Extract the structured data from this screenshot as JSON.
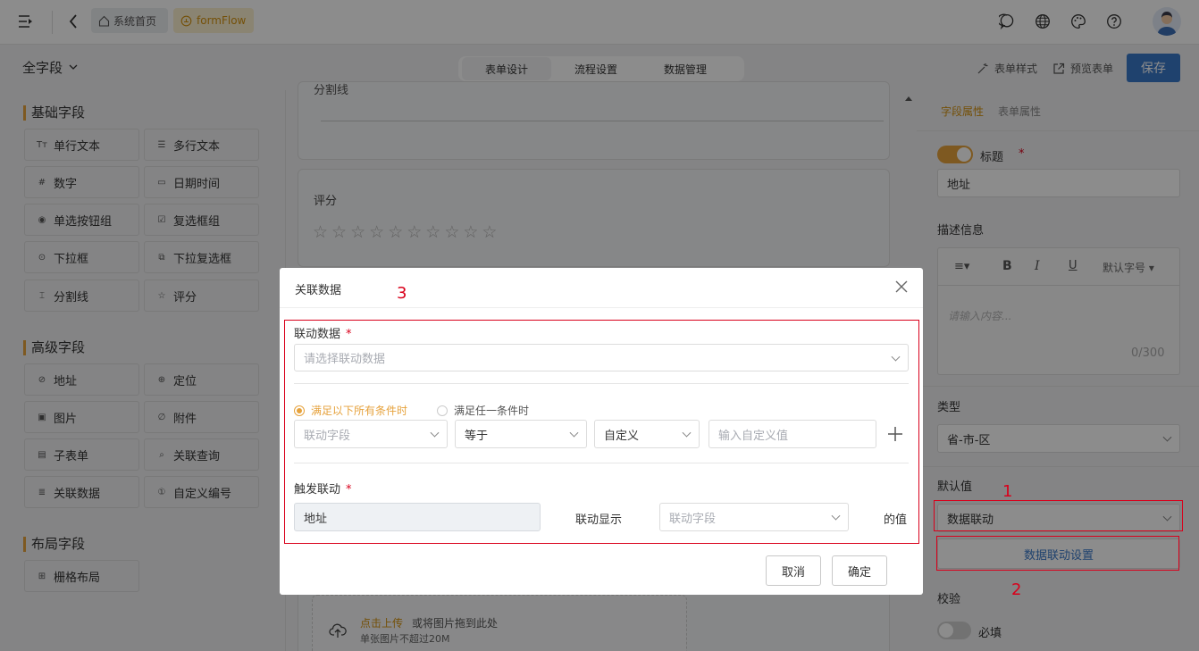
{
  "topbar": {
    "home_tag": "系统首页",
    "app_tag": "formFlow"
  },
  "subbar": {
    "field_scope": "全字段",
    "tabs": [
      "表单设计",
      "流程设置",
      "数据管理"
    ],
    "form_style": "表单样式",
    "preview": "预览表单",
    "save": "保存"
  },
  "left": {
    "basic_title": "基础字段",
    "basic_fields": [
      "单行文本",
      "多行文本",
      "数字",
      "日期时间",
      "单选按钮组",
      "复选框组",
      "下拉框",
      "下拉复选框",
      "分割线",
      "评分"
    ],
    "advanced_title": "高级字段",
    "advanced_fields": [
      "地址",
      "定位",
      "图片",
      "附件",
      "子表单",
      "关联查询",
      "关联数据",
      "自定义编号"
    ],
    "layout_title": "布局字段",
    "layout_fields": [
      "栅格布局"
    ]
  },
  "canvas": {
    "divider_label": "分割线",
    "rating_label": "评分",
    "rating_stars": 10,
    "upload_link": "点击上传",
    "upload_hint": "或将图片拖到此处",
    "upload_limit": "单张图片不超过20M"
  },
  "right": {
    "tab_field": "字段属性",
    "tab_form": "表单属性",
    "title_label": "标题",
    "title_value": "地址",
    "desc_label": "描述信息",
    "font_size": "默认字号",
    "desc_placeholder": "请输入内容...",
    "desc_counter": "0/300",
    "type_label": "类型",
    "type_value": "省-市-区",
    "default_label": "默认值",
    "default_value": "数据联动",
    "linkage_settings": "数据联动设置",
    "validate_label": "校验",
    "required_label": "必填"
  },
  "modal": {
    "title": "关联数据",
    "link_data_label": "联动数据",
    "link_data_placeholder": "请选择联动数据",
    "cond_all": "满足以下所有条件时",
    "cond_any": "满足任一条件时",
    "cond_field_placeholder": "联动字段",
    "cond_operator": "等于",
    "cond_mode": "自定义",
    "cond_value_placeholder": "输入自定义值",
    "trigger_label": "触发联动",
    "trigger_value": "地址",
    "display_text": "联动显示",
    "display_field_placeholder": "联动字段",
    "value_suffix": "的值",
    "cancel": "取消",
    "confirm": "确定"
  },
  "annotations": {
    "n1": "1",
    "n2": "2",
    "n3": "3"
  },
  "colors": {
    "accent": "#e6a23c",
    "primary": "#3a79c9",
    "annotation_red": "#d9001b"
  }
}
